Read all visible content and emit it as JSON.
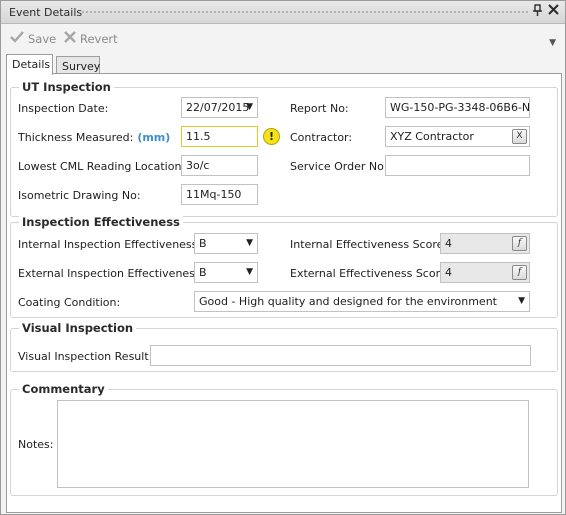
{
  "window": {
    "title": "Event Details"
  },
  "toolbar": {
    "save_label": "Save",
    "revert_label": "Revert"
  },
  "tabs": [
    {
      "label": "Details",
      "active": true
    },
    {
      "label": "Survey",
      "active": false
    }
  ],
  "ut_inspection": {
    "title": "UT Inspection",
    "inspection_date": {
      "label": "Inspection Date:",
      "value": "22/07/2015"
    },
    "thickness_measured": {
      "label": "Thickness Measured:",
      "unit": "(mm)",
      "value": "11.5"
    },
    "lowest_cml": {
      "label": "Lowest CML Reading Location:",
      "value": "3o/c"
    },
    "isometric_drawing": {
      "label": "Isometric Drawing No:",
      "value": "11Mq-150"
    },
    "report_no": {
      "label": "Report No:",
      "value": "WG-150-PG-3348-06B6-N"
    },
    "contractor": {
      "label": "Contractor:",
      "value": "XYZ Contractor"
    },
    "service_order": {
      "label": "Service Order No:",
      "value": ""
    }
  },
  "inspection_effectiveness": {
    "title": "Inspection Effectiveness",
    "internal": {
      "label": "Internal Inspection Effectiveness:",
      "value": "B"
    },
    "external": {
      "label": "External Inspection Effectiveness:",
      "value": "B"
    },
    "internal_score": {
      "label": "Internal Effectiveness Score:",
      "value": "4"
    },
    "external_score": {
      "label": "External Effectiveness Score:",
      "value": "4"
    },
    "coating": {
      "label": "Coating Condition:",
      "value": "Good - High quality and designed for the environment"
    }
  },
  "visual_inspection": {
    "title": "Visual Inspection",
    "result": {
      "label": "Visual Inspection Result:",
      "value": ""
    }
  },
  "commentary": {
    "title": "Commentary",
    "notes": {
      "label": "Notes:",
      "value": ""
    }
  },
  "glyphs": {
    "clear": "X",
    "formula": "f",
    "warning": "!"
  },
  "colors": {
    "unit_accent": "#3e8fc6",
    "warning": "#f5e21a",
    "active_border": "#e6c830"
  }
}
